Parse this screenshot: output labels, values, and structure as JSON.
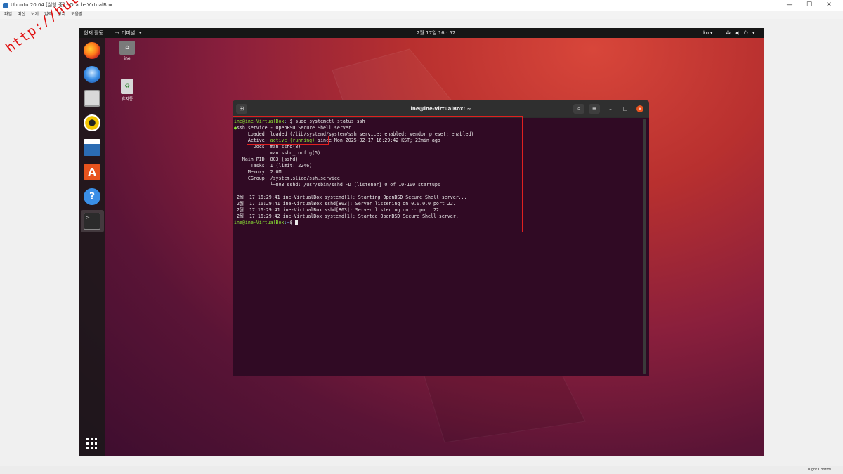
{
  "host": {
    "title": "Ubuntu 20.04 [실행 중] - Oracle VirtualBox",
    "menu": [
      "파일",
      "머신",
      "보기",
      "입력",
      "장치",
      "도움말"
    ],
    "window_buttons": [
      "—",
      "☐",
      "✕"
    ],
    "status": "Right Control"
  },
  "watermark": "http://hull.k",
  "vm": {
    "topbar": {
      "activities": "현재 활동",
      "app_menu": "터미널",
      "clock": "2월 17일 16 : 52",
      "lang": "ko"
    },
    "desktop": {
      "home_label": "ine",
      "trash_label": "휴지통"
    },
    "dock_items": [
      "firefox-icon",
      "thunderbird-icon",
      "files-icon",
      "rhythmbox-icon",
      "writer-icon",
      "software-icon",
      "help-icon",
      "terminal-icon"
    ]
  },
  "terminal": {
    "title": "ine@ine-VirtualBox: ~",
    "lines": {
      "l1_prompt": "ine@ine-VirtualBox",
      "l1_path": ":~",
      "l1_cmd": "$ sudo systemctl status ssh",
      "l2": "ssh.service - OpenBSD Secure Shell server",
      "l3": "     Loaded: loaded (/lib/systemd/system/ssh.service; enabled; vendor preset: enabled)",
      "l4_label": "     Active: ",
      "l4_state": "active (running)",
      "l4_rest": " since Mon 2025-02-17 16:29:42 KST; 22min ago",
      "l5": "       Docs: man:sshd(8)",
      "l6": "             man:sshd_config(5)",
      "l7": "   Main PID: 803 (sshd)",
      "l8": "      Tasks: 1 (limit: 2246)",
      "l9": "     Memory: 2.0M",
      "l10": "     CGroup: /system.slice/ssh.service",
      "l11": "             └─803 sshd: /usr/sbin/sshd -D [listener] 0 of 10-100 startups",
      "l12": " 2월  17 16:29:41 ine-VirtualBox systemd[1]: Starting OpenBSD Secure Shell server...",
      "l13": " 2월  17 16:29:41 ine-VirtualBox sshd[803]: Server listening on 0.0.0.0 port 22.",
      "l14": " 2월  17 16:29:41 ine-VirtualBox sshd[803]: Server listening on :: port 22.",
      "l15": " 2월  17 16:29:42 ine-VirtualBox systemd[1]: Started OpenBSD Secure Shell server.",
      "l16_prompt": "ine@ine-VirtualBox",
      "l16_path": ":~",
      "l16_end": "$ "
    }
  },
  "colors": {
    "prompt_green": "#8ae234",
    "path_blue": "#729fcf",
    "terminal_bg": "#300a24",
    "highlight_red": "#e02020"
  }
}
